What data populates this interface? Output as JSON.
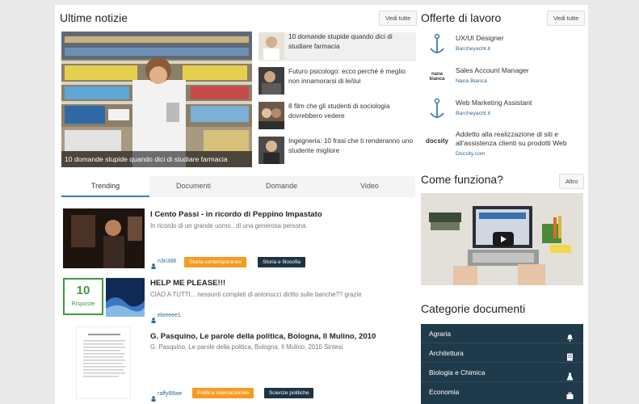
{
  "news": {
    "title": "Ultime notizie",
    "see_all": "Vedi tutte",
    "hero_caption": "10 domande stupide quando dici di studiare farmacia",
    "items": [
      {
        "text": "10 domande stupide quando dici di studiare farmacia"
      },
      {
        "text": "Futuro psicologo: ecco perché è meglio non innamorarsi di lei\\lui"
      },
      {
        "text": "8 film che gli studenti di sociologia dovrebbero vedere"
      },
      {
        "text": "Ingegneria: 10 frasi che ti renderanno uno studente migliore"
      }
    ]
  },
  "tabs": [
    "Trending",
    "Documenti",
    "Domande",
    "Video"
  ],
  "feed": [
    {
      "title": "I Cento Passi - in ricordo di Peppino Impastato",
      "desc": "In ricordo di un grande uomo.. di una generosa persona.",
      "user": "n3n386",
      "tags": [
        "Storia contemporanea",
        "Storia e filosofia"
      ]
    },
    {
      "title": "HELP ME PLEASE!!!",
      "desc": "CIAO A TUTTI... nessunti completi di antonucci diritto sulle banche?? grazie",
      "user": "eleeeee1",
      "answers_count": "10",
      "answers_label": "Risposte"
    },
    {
      "title": "G. Pasquino, Le parole della politica, Bologna, Il Mulino, 2010",
      "desc": "G. Pasquino, Le parole della politica, Bologna, Il Mulino, 2010 Sintesi",
      "user": "raffy88we",
      "tags": [
        "Politica internazionale",
        "Scienze politiche"
      ]
    }
  ],
  "jobs": {
    "title": "Offerte di lavoro",
    "see_all": "Vedi tutte",
    "items": [
      {
        "title": "UX/UI Designer",
        "company": "Barcheyacht.it"
      },
      {
        "title": "Sales Account Manager",
        "company": "Nana Bianca"
      },
      {
        "title": "Web Marketing Assistant",
        "company": "Barcheyacht.it"
      },
      {
        "title": "Addetto alla realizzazione di siti e all'assistenza clienti su prodotti Web",
        "company": "Docsity.com"
      }
    ],
    "logo_text_nana": "nana bianca",
    "logo_text_docsity": "docsity"
  },
  "how": {
    "title": "Come funziona?",
    "other": "Altro"
  },
  "categories": {
    "title": "Categorie documenti",
    "items": [
      {
        "label": "Agraria",
        "icon": "bell-icon"
      },
      {
        "label": "Architettura",
        "icon": "building-icon"
      },
      {
        "label": "Biologia e Chimica",
        "icon": "flask-icon"
      },
      {
        "label": "Economia",
        "icon": "briefcase-icon"
      }
    ]
  },
  "colors": {
    "accent": "#2e86a8",
    "tag_orange": "#f59a23",
    "tag_dark": "#1e3344",
    "category_bg": "#1f3a4b",
    "answers_green": "#3e9a3e"
  }
}
